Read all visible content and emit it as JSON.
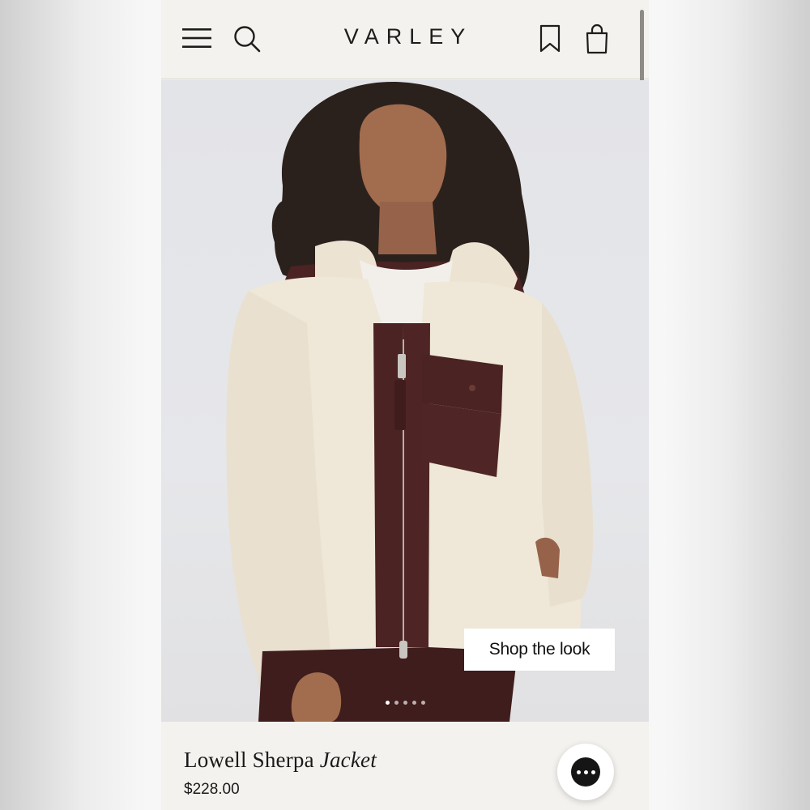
{
  "header": {
    "brand": "VARLEY",
    "icons": [
      "menu-icon",
      "search-icon",
      "bookmark-icon",
      "bag-icon"
    ]
  },
  "hero": {
    "cta_label": "Shop the look",
    "carousel": {
      "total_slides": 5,
      "active_index": 0
    }
  },
  "product": {
    "name_prefix": "Lowell Sherpa ",
    "name_italic": "Jacket",
    "price": "$228.00"
  },
  "chat": {
    "icon": "chat-icon"
  },
  "colors": {
    "background": "#f4f2ee",
    "text": "#1a1a1a",
    "jacket_cream": "#efe7d8",
    "jacket_brown": "#4a2322"
  }
}
